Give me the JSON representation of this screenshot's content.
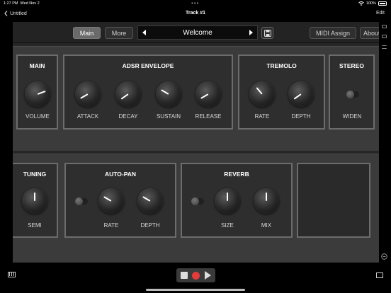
{
  "status": {
    "time": "1:27 PM",
    "date": "Wed Nov 2",
    "battery": "100%"
  },
  "nav": {
    "back_label": "Untitled",
    "title": "Track #1",
    "edit_label": "Edit"
  },
  "toolbar": {
    "main_label": "Main",
    "more_label": "More",
    "preset_name": "Welcome",
    "midi_label": "MIDI Assign",
    "about_label": "About"
  },
  "rack1": {
    "modules": [
      {
        "title": "MAIN",
        "knobs": [
          {
            "label": "VOLUME",
            "angle": 70
          }
        ]
      },
      {
        "title": "ADSR ENVELOPE",
        "knobs": [
          {
            "label": "ATTACK",
            "angle": 240
          },
          {
            "label": "DECAY",
            "angle": 235
          },
          {
            "label": "SUSTAIN",
            "angle": 300
          },
          {
            "label": "RELEASE",
            "angle": 240
          }
        ]
      },
      {
        "title": "TREMOLO",
        "knobs": [
          {
            "label": "RATE",
            "angle": 320
          },
          {
            "label": "DEPTH",
            "angle": 235
          }
        ]
      },
      {
        "title": "STEREO",
        "knobs": [
          {
            "label": "WIDEN"
          }
        ]
      }
    ]
  },
  "rack2": {
    "modules": [
      {
        "title": "TUNING",
        "knobs": [
          {
            "label": "SEMI",
            "angle": 0
          }
        ]
      },
      {
        "title": "AUTO-PAN",
        "knobs": [
          {
            "label": "RATE",
            "angle": 300
          },
          {
            "label": "DEPTH",
            "angle": 300
          }
        ]
      },
      {
        "title": "REVERB",
        "knobs": [
          {
            "label": "SIZE",
            "angle": 0
          },
          {
            "label": "MIX",
            "angle": 0
          }
        ]
      }
    ]
  },
  "colors": {
    "record": "#e23b3b",
    "panel": "#2e2e2e",
    "border": "#6c6c6c"
  },
  "icons": {
    "back": "chevron-left-icon",
    "save": "floppy-disk-icon",
    "keyboard": "piano-keyboard-icon"
  }
}
